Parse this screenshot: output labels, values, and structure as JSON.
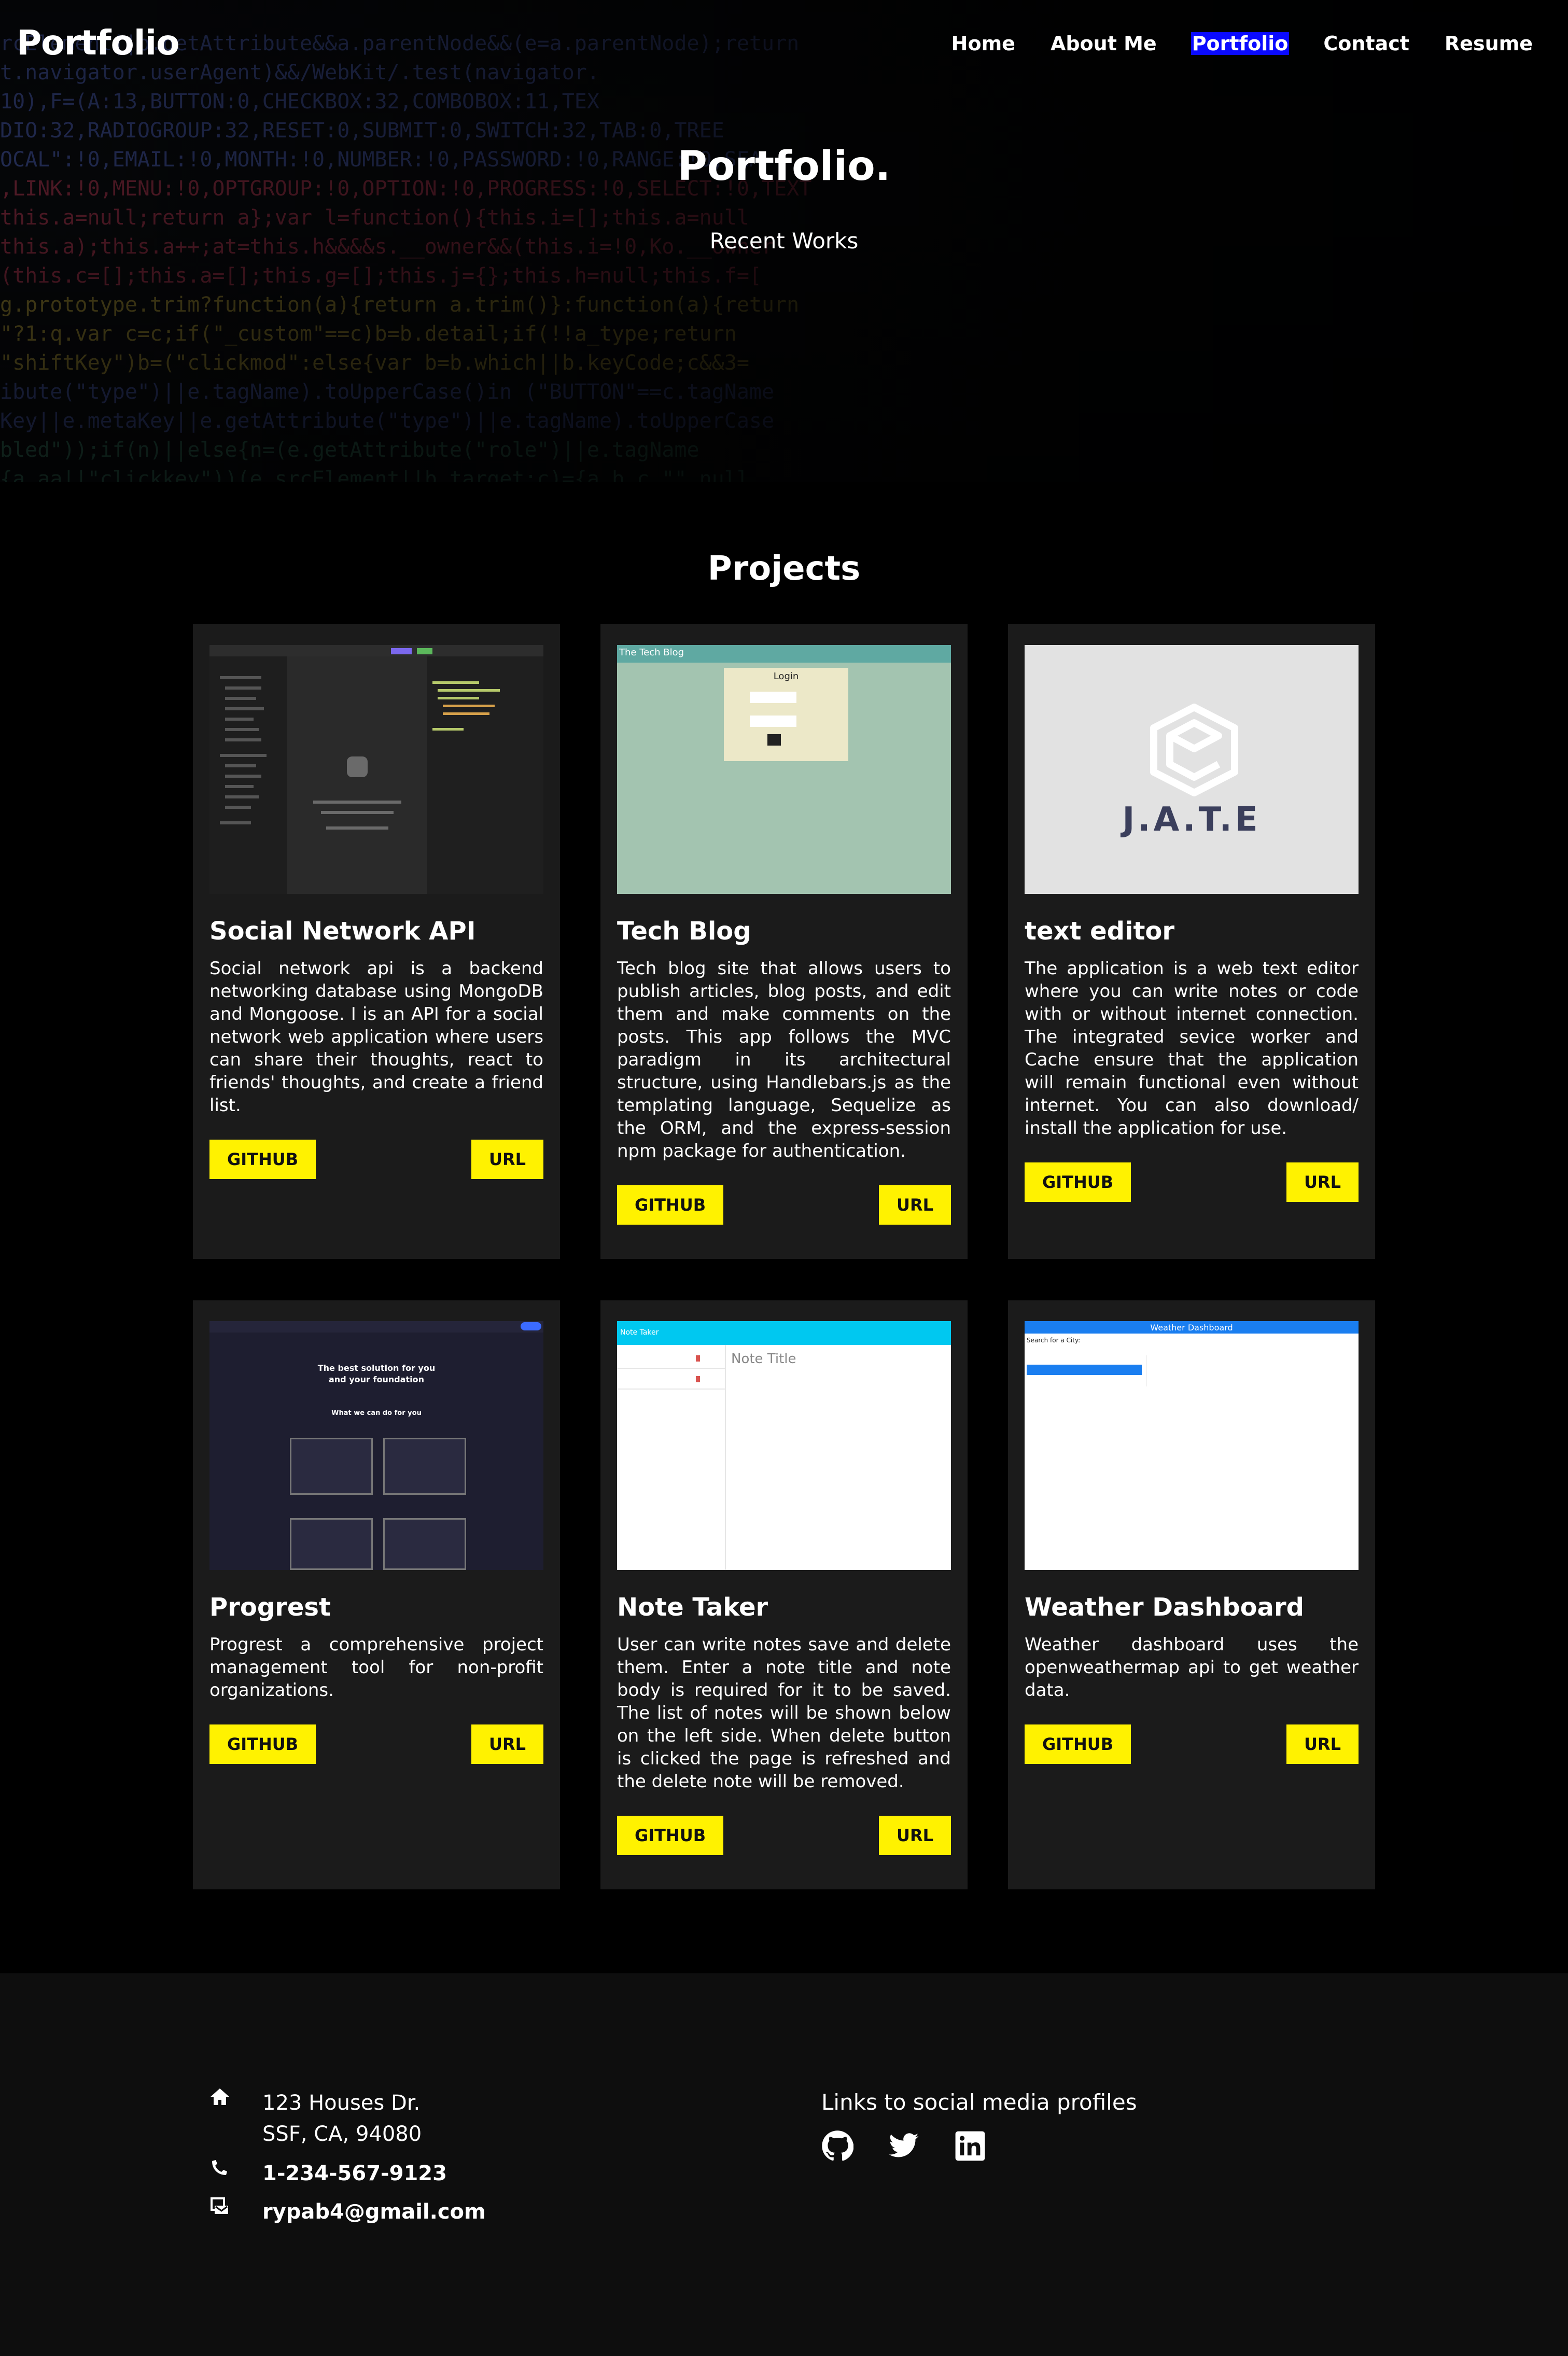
{
  "brand": "Portfolio",
  "nav": [
    {
      "label": "Home",
      "active": false
    },
    {
      "label": "About Me",
      "active": false
    },
    {
      "label": "Portfolio",
      "active": true
    },
    {
      "label": "Contact",
      "active": false
    },
    {
      "label": "Resume",
      "active": false
    }
  ],
  "hero": {
    "title": "Portfolio.",
    "subtitle": "Recent Works"
  },
  "projects": {
    "heading": "Projects",
    "items": [
      {
        "title": "Social Network API",
        "description": "Social network api is a backend networking database using MongoDB and Mongoose. I is an API for a social network web application where users can share their thoughts, react to friends' thoughts, and create a friend list.",
        "github_label": "GITHUB",
        "url_label": "URL"
      },
      {
        "title": "Tech Blog",
        "description": "Tech blog site that allows users to publish articles, blog posts, and edit them and make comments on the posts. This app follows the MVC paradigm in its architectural structure, using Handlebars.js as the templating language, Sequelize as the ORM, and the express-session npm package for authentication.",
        "github_label": "GITHUB",
        "url_label": "URL",
        "thumb": {
          "header": "The Tech Blog",
          "box_title": "Login"
        }
      },
      {
        "title": "text editor",
        "description": "The application is a web text editor where you can write notes or code with or without internet connection. The integrated sevice worker and Cache ensure that the application will remain functional even without internet. You can also download/ install the application for use.",
        "github_label": "GITHUB",
        "url_label": "URL",
        "thumb": {
          "logo_text": "J.A.T.E"
        }
      },
      {
        "title": "Progrest",
        "description": "Progrest a comprehensive project management tool for non-profit organizations.",
        "github_label": "GITHUB",
        "url_label": "URL",
        "thumb": {
          "headline": "The best solution for you and your foundation",
          "sub": "What we can do for you"
        }
      },
      {
        "title": "Note Taker",
        "description": "User can write notes save and delete them. Enter a note title and note body is required for it to be saved. The list of notes will be shown below on the left side. When delete button is clicked the page is refreshed and the delete note will be removed.",
        "github_label": "GITHUB",
        "url_label": "URL",
        "thumb": {
          "header": "Note Taker",
          "note_title": "Note Title"
        }
      },
      {
        "title": "Weather Dashboard",
        "description": "Weather dashboard uses the openweathermap api to get weather data.",
        "github_label": "GITHUB",
        "url_label": "URL",
        "thumb": {
          "header": "Weather Dashboard",
          "search_label": "Search for a City:"
        }
      }
    ]
  },
  "footer": {
    "address_line1": "123 Houses Dr.",
    "address_line2": "SSF, CA, 94080",
    "phone": "1-234-567-9123",
    "email": "rypab4@gmail.com",
    "social_label": "Links to social media profiles",
    "social_icons": [
      "github-icon",
      "twitter-icon",
      "linkedin-icon"
    ]
  },
  "colors": {
    "accent_button": "#fff200",
    "nav_active": "#0a0aff",
    "card_bg": "#1b1b1b",
    "footer_bg": "#0e0e0e"
  }
}
